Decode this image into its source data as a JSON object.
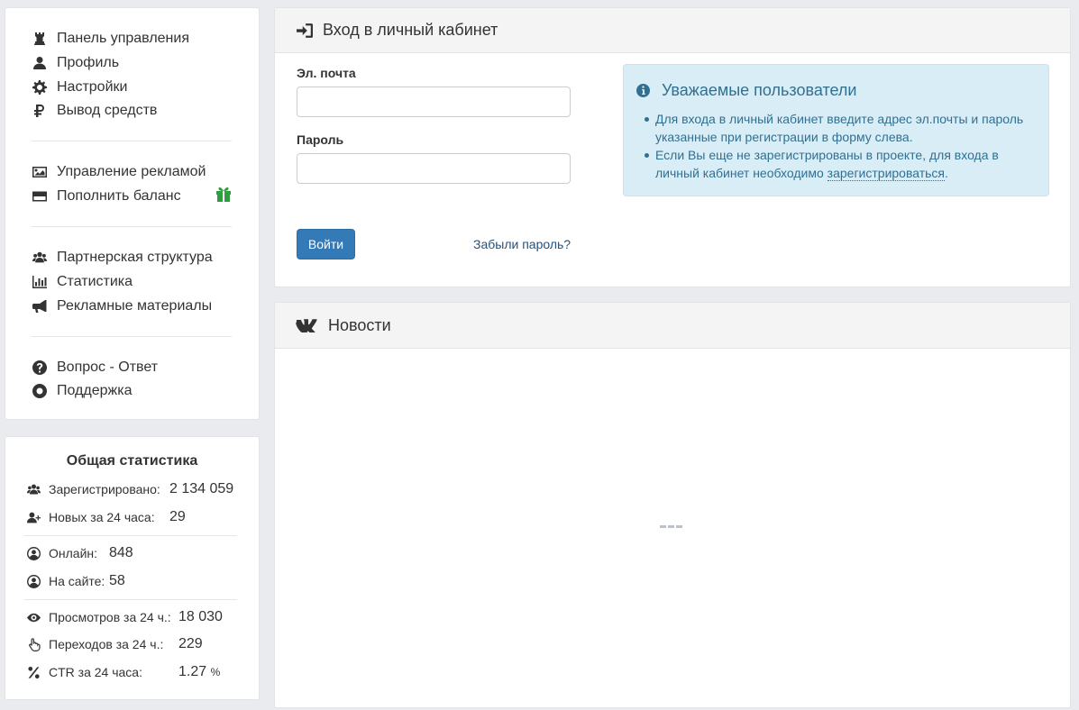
{
  "sidebar": {
    "groups": [
      {
        "items": [
          {
            "label": "Панель управления",
            "icon": "dashboard-icon"
          },
          {
            "label": "Профиль",
            "icon": "user-icon"
          },
          {
            "label": "Настройки",
            "icon": "gear-icon"
          },
          {
            "label": "Вывод средств",
            "icon": "ruble-icon"
          }
        ]
      },
      {
        "items": [
          {
            "label": "Управление рекламой",
            "icon": "image-icon"
          },
          {
            "label": "Пополнить баланс",
            "icon": "credit-card-icon"
          }
        ]
      },
      {
        "items": [
          {
            "label": "Партнерская структура",
            "icon": "users-icon"
          },
          {
            "label": "Статистика",
            "icon": "bar-chart-icon"
          },
          {
            "label": "Рекламные материалы",
            "icon": "bullhorn-icon"
          }
        ]
      },
      {
        "items": [
          {
            "label": "Вопрос - Ответ",
            "icon": "question-circle-icon"
          },
          {
            "label": "Поддержка",
            "icon": "life-ring-icon"
          }
        ]
      }
    ],
    "gift_icon_color": "#2e9e3f"
  },
  "stats": {
    "title": "Общая статистика",
    "rows": [
      {
        "label": "Зарегистрировано:",
        "value": "2 134 059",
        "icon": "users-icon"
      },
      {
        "label": "Новых за 24 часа:",
        "value": "29",
        "icon": "user-plus-icon"
      },
      {
        "label": "Онлайн:",
        "value": "848",
        "icon": "user-circle-icon"
      },
      {
        "label": "На сайте:",
        "value": "58",
        "icon": "user-circle-icon"
      },
      {
        "label": "Просмотров за 24 ч.:",
        "value": "18 030",
        "icon": "eye-icon"
      },
      {
        "label": "Переходов за 24 ч.:",
        "value": "229",
        "icon": "pointer-hand-icon"
      },
      {
        "label": "CTR за 24 часа:",
        "value": "1.27",
        "unit": "%",
        "icon": "percent-icon"
      }
    ]
  },
  "login": {
    "title": "Вход в личный кабинет",
    "email_label": "Эл. почта",
    "email_value": "",
    "password_label": "Пароль",
    "password_value": "",
    "submit_label": "Войти",
    "forgot_label": "Забыли пароль?",
    "info": {
      "title": "Уважаемые пользователи",
      "item1": "Для входа в личный кабинет введите адрес эл.почты и пароль указанные при регистрации в форму слева.",
      "item2_prefix": "Если Вы еще не зарегистрированы в проекте, для входа в личный кабинет необходимо ",
      "item2_link": "зарегистрироваться",
      "item2_suffix": "."
    }
  },
  "news": {
    "title": "Новости",
    "icon": "vk-icon"
  },
  "colors": {
    "primary": "#337ab7",
    "info_bg": "#d9edf7",
    "info_text": "#31708f",
    "page_bg": "#eaebee"
  }
}
